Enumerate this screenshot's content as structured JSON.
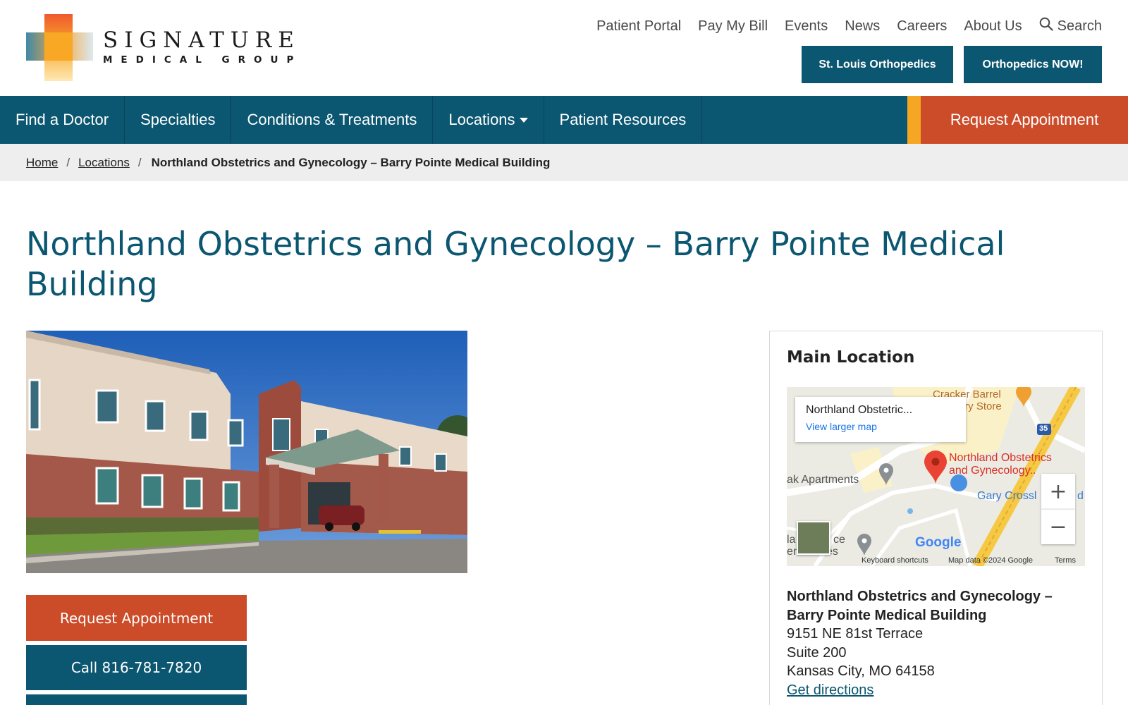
{
  "brand": {
    "name_line1": "SIGNATURE",
    "name_line2": "MEDICAL GROUP"
  },
  "utility_nav": {
    "items": [
      "Patient Portal",
      "Pay My Bill",
      "Events",
      "News",
      "Careers",
      "About Us"
    ],
    "search_label": "Search",
    "search_icon": "magnifier"
  },
  "quick_buttons": [
    "St. Louis Orthopedics",
    "Orthopedics NOW!"
  ],
  "main_nav": {
    "items": [
      "Find a Doctor",
      "Specialties",
      "Conditions & Treatments",
      "Locations",
      "Patient Resources"
    ],
    "locations_icon": "caret-down",
    "request_label": "Request Appointment"
  },
  "breadcrumb": {
    "home": "Home",
    "locations": "Locations",
    "sep": "/",
    "current": "Northland Obstetrics and Gynecology – Barry Pointe Medical Building"
  },
  "page": {
    "title": "Northland Obstetrics and Gynecology – Barry Pointe Medical Building"
  },
  "actions": {
    "request": "Request Appointment",
    "call": "Call 816-781-7820"
  },
  "location_card": {
    "heading": "Main Location",
    "map": {
      "place_name": "Northland Obstetric...",
      "view_larger": "View larger map",
      "marker_label_1": "Northland Obstetrics",
      "marker_label_2": "and Gynecology..",
      "poi_cracker_1": "Cracker Barrel",
      "poi_cracker_2": "try Store",
      "poi_apartments": "ak Apartments",
      "poi_gary": "Gary Crossl",
      "poi_gary_tail": "d",
      "poi_left_1": "la",
      "poi_left_1b": "ce",
      "poi_left_2": "en Homes",
      "highway": "35",
      "zoom_in": "+",
      "zoom_out": "−",
      "google": "Google",
      "keyboard_shortcuts": "Keyboard shortcuts",
      "map_data": "Map data ©2024 Google",
      "terms": "Terms",
      "colors": {
        "marker": "#ea4335",
        "road": "#f6c945",
        "link": "#1a73e8"
      }
    },
    "address": {
      "name_line1": "Northland Obstetrics and Gynecology –",
      "name_line2": "Barry Pointe Medical Building",
      "street": "9151 NE 81st Terrace",
      "suite": "Suite 200",
      "city": "Kansas City, MO 64158",
      "directions": "Get directions"
    }
  },
  "colors": {
    "primary_teal": "#0b5670",
    "accent_orange": "#cc4b29",
    "accent_yellow": "#f5a623",
    "breadcrumb_bg": "#eeeeee"
  }
}
